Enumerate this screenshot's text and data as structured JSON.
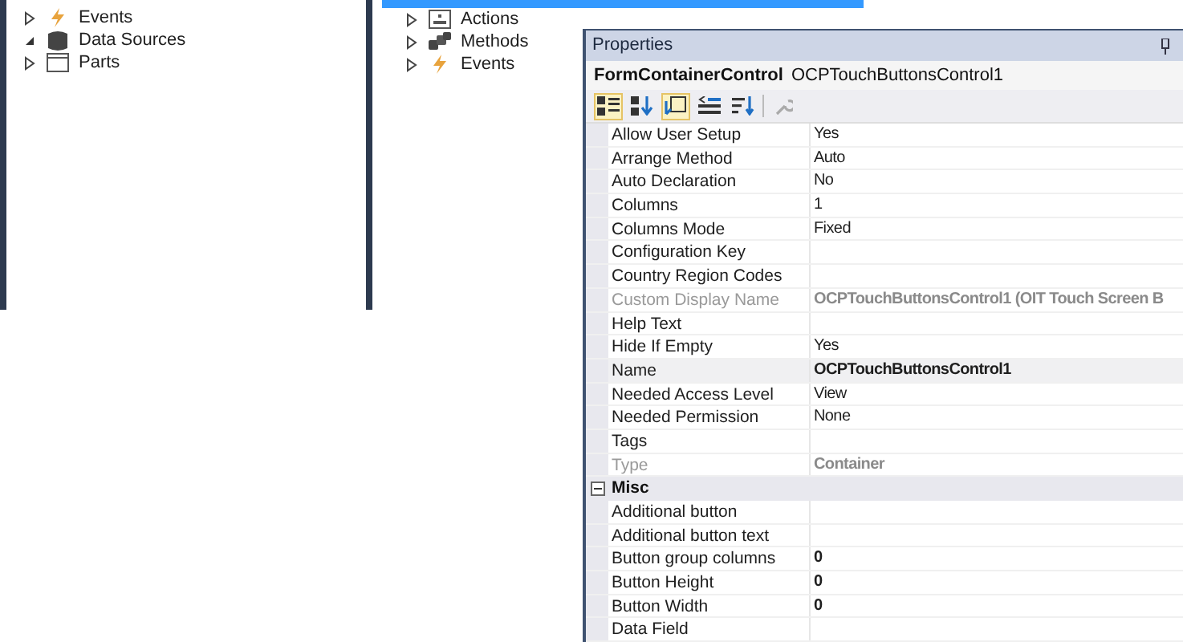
{
  "left_tree": {
    "items": [
      {
        "label": "Events",
        "kind": "events",
        "expanded": false
      },
      {
        "label": "Data Sources",
        "kind": "datasource",
        "expanded": true
      },
      {
        "label": "Parts",
        "kind": "parts",
        "expanded": false
      }
    ]
  },
  "middle_tree": {
    "items": [
      {
        "label": "Actions",
        "kind": "actions",
        "expanded": false
      },
      {
        "label": "Methods",
        "kind": "methods",
        "expanded": false
      },
      {
        "label": "Events",
        "kind": "events",
        "expanded": false
      }
    ]
  },
  "properties": {
    "title": "Properties",
    "object_type": "FormContainerControl",
    "object_name": "OCPTouchButtonsControl1",
    "toolbar": [
      {
        "kind": "categorized",
        "selected": true
      },
      {
        "kind": "alphabetical",
        "selected": false
      },
      {
        "kind": "properties",
        "selected": true
      },
      {
        "kind": "events",
        "selected": false
      },
      {
        "kind": "sort",
        "selected": false
      },
      {
        "kind": "wrench",
        "selected": false
      }
    ],
    "rows": [
      {
        "kind": "property",
        "label": "Allow User Setup",
        "value": "Yes",
        "bold": false,
        "disabled": false,
        "selected": false
      },
      {
        "kind": "property",
        "label": "Arrange Method",
        "value": "Auto",
        "bold": false,
        "disabled": false,
        "selected": false
      },
      {
        "kind": "property",
        "label": "Auto Declaration",
        "value": "No",
        "bold": false,
        "disabled": false,
        "selected": false
      },
      {
        "kind": "property",
        "label": "Columns",
        "value": "1",
        "bold": false,
        "disabled": false,
        "selected": false
      },
      {
        "kind": "property",
        "label": "Columns Mode",
        "value": "Fixed",
        "bold": false,
        "disabled": false,
        "selected": false
      },
      {
        "kind": "property",
        "label": "Configuration Key",
        "disabled": false,
        "selected": false
      },
      {
        "kind": "property",
        "label": "Country Region Codes",
        "disabled": false,
        "selected": false
      },
      {
        "kind": "property",
        "label": "Custom Display Name",
        "value": "OCPTouchButtonsControl1 (OIT Touch Screen B",
        "bold": true,
        "disabled": true,
        "selected": false
      },
      {
        "kind": "property",
        "label": "Help Text",
        "disabled": false,
        "selected": false
      },
      {
        "kind": "property",
        "label": "Hide If Empty",
        "value": "Yes",
        "bold": false,
        "disabled": false,
        "selected": false
      },
      {
        "kind": "property",
        "label": "Name",
        "value": "OCPTouchButtonsControl1",
        "bold": true,
        "disabled": false,
        "selected": true
      },
      {
        "kind": "property",
        "label": "Needed Access Level",
        "value": "View",
        "bold": false,
        "disabled": false,
        "selected": false
      },
      {
        "kind": "property",
        "label": "Needed Permission",
        "value": "None",
        "bold": false,
        "disabled": false,
        "selected": false
      },
      {
        "kind": "property",
        "label": "Tags",
        "disabled": false,
        "selected": false
      },
      {
        "kind": "property",
        "label": "Type",
        "value": "Container",
        "bold": true,
        "disabled": true,
        "selected": false
      },
      {
        "kind": "category",
        "label": "Misc",
        "expanded": true
      },
      {
        "kind": "property",
        "label": "Additional button",
        "disabled": false,
        "selected": false
      },
      {
        "kind": "property",
        "label": "Additional button text",
        "disabled": false,
        "selected": false
      },
      {
        "kind": "property",
        "label": "Button group columns",
        "value": "0",
        "bold": true,
        "disabled": false,
        "selected": false
      },
      {
        "kind": "property",
        "label": "Button Height",
        "value": "0",
        "bold": true,
        "disabled": false,
        "selected": false
      },
      {
        "kind": "property",
        "label": "Button Width",
        "value": "0",
        "bold": true,
        "disabled": false,
        "selected": false
      },
      {
        "kind": "property",
        "label": "Data Field",
        "disabled": false,
        "selected": false
      }
    ]
  }
}
